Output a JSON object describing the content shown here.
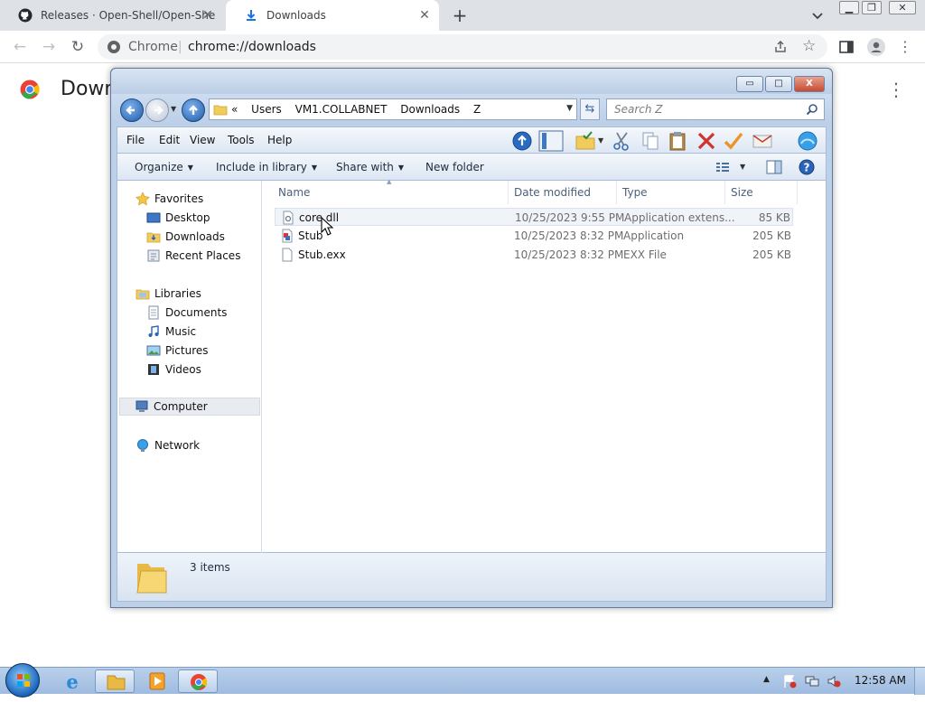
{
  "browser": {
    "tabs": [
      {
        "title": "Releases · Open-Shell/Open-She",
        "active": false
      },
      {
        "title": "Downloads",
        "active": true
      }
    ],
    "omnibox": {
      "origin": "Chrome",
      "separator": "|",
      "url": "chrome://downloads"
    },
    "page_title": "Down"
  },
  "explorer": {
    "caption_buttons": {
      "minimize": "▭",
      "maximize": "□",
      "close": "X"
    },
    "breadcrumb": [
      "«",
      "Users",
      "VM1.COLLABNET",
      "Downloads",
      "Z"
    ],
    "search_placeholder": "Search Z",
    "menu": [
      "File",
      "Edit",
      "View",
      "Tools",
      "Help"
    ],
    "commands": [
      {
        "label": "Organize",
        "dropdown": true
      },
      {
        "label": "Include in library",
        "dropdown": true
      },
      {
        "label": "Share with",
        "dropdown": true
      },
      {
        "label": "New folder",
        "dropdown": false
      }
    ],
    "nav": {
      "favorites_header": "Favorites",
      "favorites": [
        "Desktop",
        "Downloads",
        "Recent Places"
      ],
      "libraries_header": "Libraries",
      "libraries": [
        "Documents",
        "Music",
        "Pictures",
        "Videos"
      ],
      "computer": "Computer",
      "network": "Network"
    },
    "columns": [
      "Name",
      "Date modified",
      "Type",
      "Size"
    ],
    "files": [
      {
        "name": "core.dll",
        "date": "10/25/2023 9:55 PM",
        "type": "Application extens...",
        "size": "85 KB",
        "icon": "dll-icon"
      },
      {
        "name": "Stub",
        "date": "10/25/2023 8:32 PM",
        "type": "Application",
        "size": "205 KB",
        "icon": "application-icon"
      },
      {
        "name": "Stub.exx",
        "date": "10/25/2023 8:32 PM",
        "type": "EXX File",
        "size": "205 KB",
        "icon": "generic-file-icon"
      }
    ],
    "status": "3 items"
  },
  "taskbar": {
    "clock": "12:58 AM"
  },
  "colors": {
    "tabstrip": "#dee1e6",
    "explorer_frame": "#bcd0e8",
    "taskbar": "#a9c3e4",
    "close_red": "#c64a31"
  }
}
